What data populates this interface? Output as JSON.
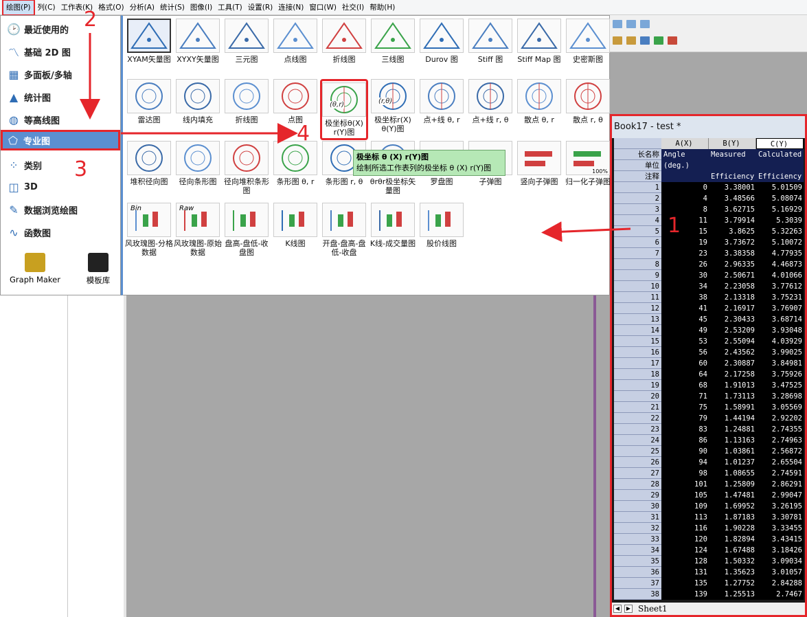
{
  "menubar": {
    "items": [
      "绘图(P)",
      "列(C)",
      "工作表(K)",
      "格式(O)",
      "分析(A)",
      "统计(S)",
      "图像(I)",
      "工具(T)",
      "设置(R)",
      "连接(N)",
      "窗口(W)",
      "社交(I)",
      "帮助(H)"
    ]
  },
  "submenu": {
    "items": [
      {
        "label": "最近使用的",
        "icon": "clock-icon"
      },
      {
        "label": "基础 2D 图",
        "icon": "line-chart-icon"
      },
      {
        "label": "多面板/多轴",
        "icon": "multi-panel-icon"
      },
      {
        "label": "统计图",
        "icon": "histogram-icon"
      },
      {
        "label": "等高线图",
        "icon": "contour-icon"
      },
      {
        "label": "专业图",
        "icon": "pentagon-icon"
      },
      {
        "label": "类别",
        "icon": "category-icon"
      },
      {
        "label": "3D",
        "icon": "3d-icon"
      },
      {
        "label": "数据浏览绘图",
        "icon": "data-explore-icon"
      },
      {
        "label": "函数图",
        "icon": "function-icon"
      }
    ],
    "graph_maker": "Graph Maker",
    "template_lib": "模板库"
  },
  "gallery": {
    "row1": [
      "XYAM矢量图",
      "XYXY矢量图",
      "三元图",
      "点线图",
      "折线图",
      "三线图",
      "Durov 图",
      "Stiff 图",
      "Stiff Map 图",
      "史密斯图"
    ],
    "row2": [
      "雷达图",
      "线内填充",
      "折线图",
      "点图",
      "极坐标θ(X) r(Y)图",
      "极坐标r(X) θ(Y)图",
      "点+线 θ, r",
      "点+线 r, θ",
      "散点 θ, r",
      "散点 r, θ"
    ],
    "row3": [
      "堆积径向图",
      "径向条形图",
      "径向堆积条形图",
      "条形图 θ, r",
      "条形图 r, θ",
      "θrθr极坐标矢量图",
      "罗盘图",
      "子弹图",
      "竖向子弹图",
      "归一化子弹图"
    ],
    "row4": [
      "风玫瑰图-分格数据",
      "风玫瑰图-原始数据",
      "盘高-盘低-收盘图",
      "K线图",
      "开盘-盘高-盘低-收盘",
      "K线-成交量图",
      "股价线图"
    ],
    "badge": "100%",
    "bin": "Bin",
    "raw": "Raw",
    "polar_tag1": "(θ,r)",
    "polar_tag2": "(r,θ)"
  },
  "tooltip": {
    "title": "极坐标 θ (X) r(Y)图",
    "desc": "绘制所选工作表列的极坐标 θ (X) r(Y)图"
  },
  "annotations": [
    "1",
    "2",
    "3",
    "4"
  ],
  "book": {
    "title": "Book17 - test *",
    "columns": [
      "A(X)",
      "B(Y)",
      "C(Y)"
    ],
    "meta": [
      {
        "label": "长名称",
        "values": [
          "Angle",
          "Measured",
          "Calculated"
        ]
      },
      {
        "label": "单位",
        "values": [
          "(deg.)",
          "",
          ""
        ]
      },
      {
        "label": "注释",
        "values": [
          "",
          "Efficiency",
          "Efficiency"
        ]
      }
    ],
    "rows": [
      [
        1,
        "0",
        "3.38001",
        "5.01509"
      ],
      [
        2,
        "4",
        "3.48566",
        "5.08074"
      ],
      [
        3,
        "8",
        "3.62715",
        "5.16929"
      ],
      [
        4,
        "11",
        "3.79914",
        "5.3039"
      ],
      [
        5,
        "15",
        "3.8625",
        "5.32263"
      ],
      [
        6,
        "19",
        "3.73672",
        "5.10072"
      ],
      [
        7,
        "23",
        "3.38358",
        "4.77935"
      ],
      [
        8,
        "26",
        "2.96335",
        "4.46873"
      ],
      [
        9,
        "30",
        "2.50671",
        "4.01066"
      ],
      [
        10,
        "34",
        "2.23058",
        "3.77612"
      ],
      [
        11,
        "38",
        "2.13318",
        "3.75231"
      ],
      [
        12,
        "41",
        "2.16917",
        "3.76907"
      ],
      [
        13,
        "45",
        "2.30433",
        "3.68714"
      ],
      [
        14,
        "49",
        "2.53209",
        "3.93048"
      ],
      [
        15,
        "53",
        "2.55094",
        "4.03929"
      ],
      [
        16,
        "56",
        "2.43562",
        "3.99025"
      ],
      [
        17,
        "60",
        "2.30887",
        "3.84981"
      ],
      [
        18,
        "64",
        "2.17258",
        "3.75926"
      ],
      [
        19,
        "68",
        "1.91013",
        "3.47525"
      ],
      [
        20,
        "71",
        "1.73113",
        "3.28698"
      ],
      [
        21,
        "75",
        "1.58991",
        "3.05569"
      ],
      [
        22,
        "79",
        "1.44194",
        "2.92202"
      ],
      [
        23,
        "83",
        "1.24881",
        "2.74355"
      ],
      [
        24,
        "86",
        "1.13163",
        "2.74963"
      ],
      [
        25,
        "90",
        "1.03861",
        "2.56872"
      ],
      [
        26,
        "94",
        "1.01237",
        "2.65504"
      ],
      [
        27,
        "98",
        "1.08655",
        "2.74591"
      ],
      [
        28,
        "101",
        "1.25809",
        "2.86291"
      ],
      [
        29,
        "105",
        "1.47481",
        "2.99047"
      ],
      [
        30,
        "109",
        "1.69952",
        "3.26195"
      ],
      [
        31,
        "113",
        "1.87183",
        "3.30781"
      ],
      [
        32,
        "116",
        "1.90228",
        "3.33455"
      ],
      [
        33,
        "120",
        "1.82894",
        "3.43415"
      ],
      [
        34,
        "124",
        "1.67488",
        "3.18426"
      ],
      [
        35,
        "128",
        "1.50332",
        "3.09034"
      ],
      [
        36,
        "131",
        "1.35623",
        "3.01057"
      ],
      [
        37,
        "135",
        "1.27752",
        "2.84288"
      ],
      [
        38,
        "139",
        "1.25513",
        "2.7467"
      ]
    ],
    "sheet_tab": "Sheet1"
  },
  "colors": {
    "accent": "#5b8fd0",
    "annotation": "#e5262b",
    "tooltip": "#b6e8b6"
  }
}
